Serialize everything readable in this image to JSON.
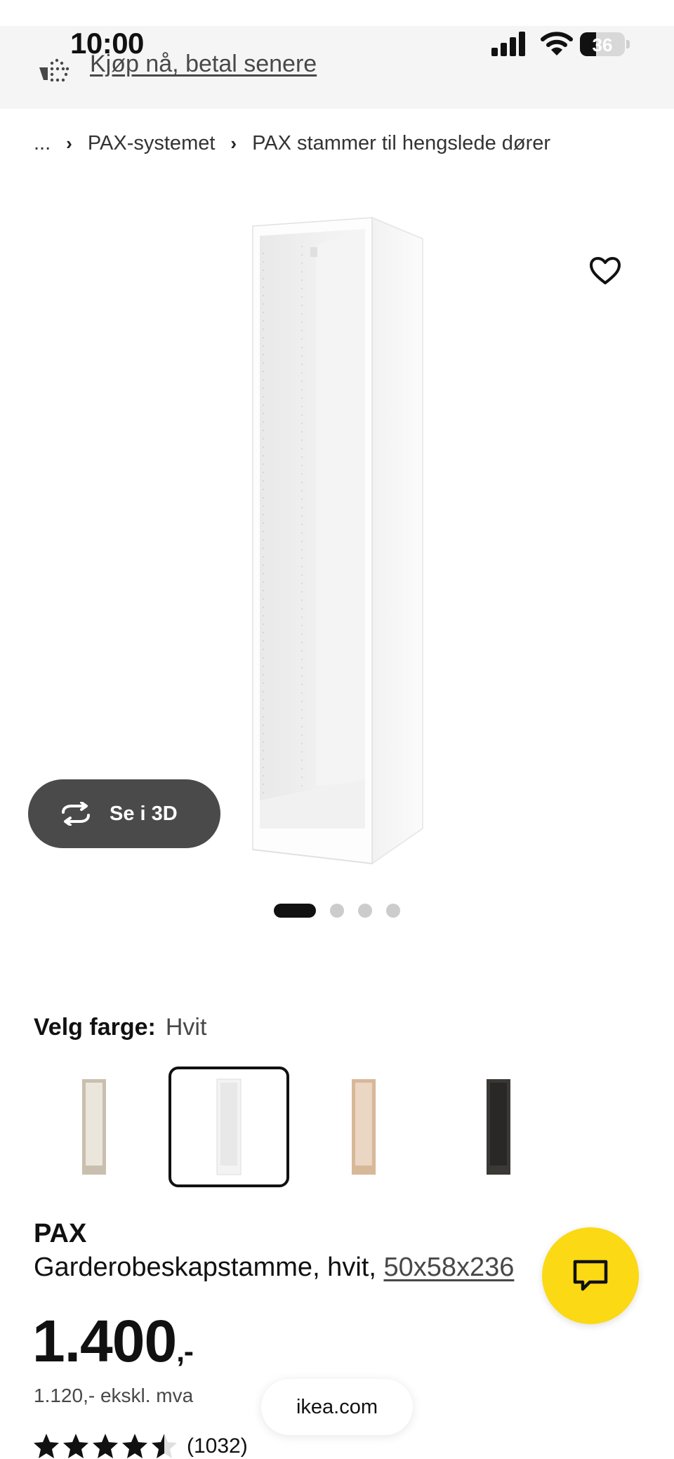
{
  "status_bar": {
    "time": "10:00",
    "battery": "36",
    "battery_level": 0.36
  },
  "banner": {
    "link_text": "Kjøp nå, betal senere",
    "icon": "bnpl-basket-icon"
  },
  "breadcrumb": {
    "items": [
      "...",
      "PAX-systemet",
      "PAX stammer til hengslede dører"
    ],
    "separator_icon": "chevron-right-icon"
  },
  "gallery": {
    "view_3d_label": "Se i 3D",
    "view_3d_icon": "rotate-arrows-icon",
    "favorite_icon": "heart-outline-icon",
    "slide_count": 4,
    "active_slide": 1
  },
  "color": {
    "label": "Velg farge:",
    "selected": "Hvit",
    "swatches": [
      {
        "name": "swatch-beige",
        "color": "#c9bfae",
        "selected": false
      },
      {
        "name": "swatch-white",
        "color": "#f3f3f3",
        "selected": true
      },
      {
        "name": "swatch-oak",
        "color": "#d7b898",
        "selected": false
      },
      {
        "name": "swatch-black-brown",
        "color": "#3b3935",
        "selected": false
      }
    ]
  },
  "product": {
    "name": "PAX",
    "description": "Garderobeskapstamme, hvit, ",
    "size": "50x58x236",
    "price_main": "1.400",
    "price_suffix": ",-",
    "price_ex_vat": "1.120,- ekskl. mva",
    "rating_value": 4.5,
    "rating_count": "(1032)"
  },
  "browser": {
    "url": "ikea.com"
  },
  "chat": {
    "icon": "chat-bubble-icon"
  },
  "colors": {
    "chat_yellow": "#fbd914",
    "pill_dark": "#4a4a4a",
    "banner_bg": "#f5f5f5"
  }
}
